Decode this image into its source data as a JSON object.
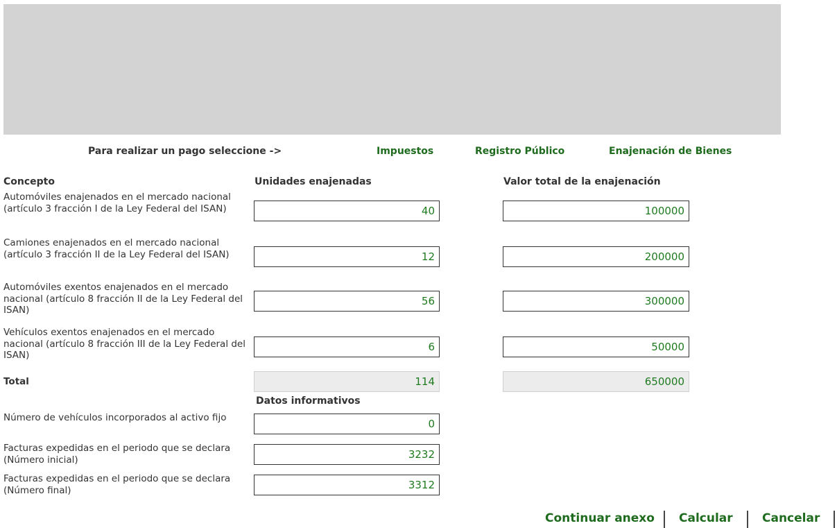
{
  "nav": {
    "prompt": "Para realizar un pago seleccione ->",
    "links": [
      "Impuestos",
      "Registro Público",
      "Enajenación de Bienes"
    ]
  },
  "headers": {
    "concepto": "Concepto",
    "unidades": "Unidades enajenadas",
    "valor": "Valor total de la enajenación"
  },
  "rows": [
    {
      "label": "Automóviles enajenados en el mercado nacional (artículo 3 fracción I de la Ley Federal del ISAN)",
      "units": "40",
      "value": "100000"
    },
    {
      "label": "Camiones enajenados en el mercado nacional (artículo 3 fracción II de la Ley Federal del ISAN)",
      "units": "12",
      "value": "200000"
    },
    {
      "label": "Automóviles exentos enajenados en el mercado nacional (artículo 8 fracción II de la Ley Federal del ISAN)",
      "units": "56",
      "value": "300000"
    },
    {
      "label": "Vehículos exentos enajenados en el mercado nacional (artículo 8 fracción III de la Ley Federal del ISAN)",
      "units": "6",
      "value": "50000"
    }
  ],
  "total": {
    "label": "Total",
    "units": "114",
    "value": "650000"
  },
  "informativos": {
    "title": "Datos informativos",
    "rows": [
      {
        "label": "Número de vehículos incorporados al activo fijo",
        "value": "0"
      },
      {
        "label": "Facturas expedidas en el periodo que se declara (Número inicial)",
        "value": "3232"
      },
      {
        "label": "Facturas expedidas en el periodo que se declara (Número final)",
        "value": "3312"
      }
    ]
  },
  "buttons": {
    "continuar": "Continuar anexo",
    "calcular": "Calcular",
    "cancelar": "Cancelar"
  },
  "colors": {
    "link": "#1e6b1e",
    "value": "#1e7a1e",
    "banner": "#d3d3d3"
  }
}
